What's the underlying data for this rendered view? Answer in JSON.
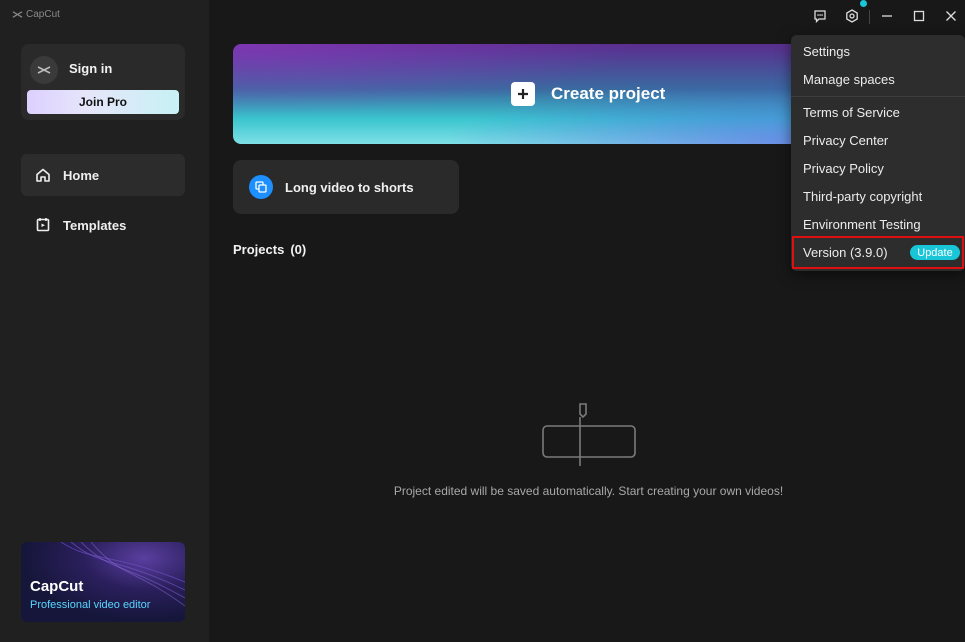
{
  "app": {
    "logo_text": "CapCut"
  },
  "account": {
    "signin_label": "Sign in",
    "join_pro_label": "Join Pro"
  },
  "nav": {
    "items": [
      {
        "label": "Home"
      },
      {
        "label": "Templates"
      }
    ]
  },
  "promo": {
    "title": "CapCut",
    "subtitle": "Professional video editor"
  },
  "main": {
    "create_label": "Create project",
    "shorts_label": "Long video to shorts",
    "projects_label": "Projects",
    "projects_count": "(0)",
    "empty_message": "Project edited will be saved automatically. Start creating your own videos!"
  },
  "menu": {
    "items": [
      {
        "label": "Settings"
      },
      {
        "label": "Manage spaces"
      },
      {
        "label": "Terms of Service"
      },
      {
        "label": "Privacy Center"
      },
      {
        "label": "Privacy Policy"
      },
      {
        "label": "Third-party copyright"
      },
      {
        "label": "Environment Testing"
      },
      {
        "label": "Version (3.9.0)"
      }
    ],
    "update_label": "Update"
  },
  "colors": {
    "accent": "#19c6d8",
    "highlight": "#e01010",
    "shorts_icon": "#1e8fff"
  },
  "icons": [
    "capcut-logo-icon",
    "home-icon",
    "templates-icon",
    "plus-icon",
    "shorts-icon",
    "feedback-icon",
    "settings-icon",
    "minimize-icon",
    "maximize-icon",
    "close-icon",
    "empty-project-icon"
  ]
}
